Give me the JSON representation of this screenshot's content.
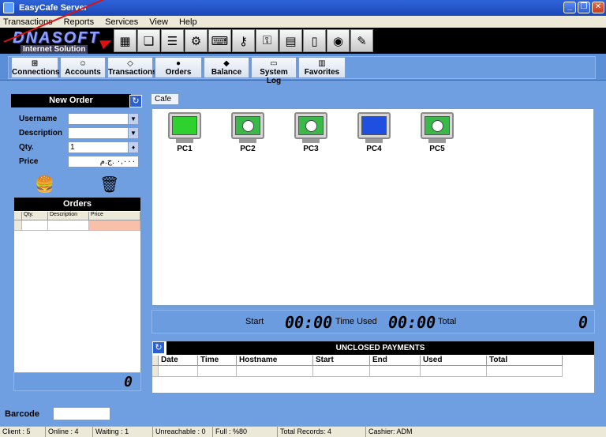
{
  "window": {
    "title": "EasyCafe Server"
  },
  "menu": [
    "Transactions",
    "Reports",
    "Services",
    "View",
    "Help"
  ],
  "logo": {
    "main": "DNASOFT",
    "sub": "Internet Solution"
  },
  "toolbar": [
    "calculator-icon",
    "documents-icon",
    "report-icon",
    "settings-gear-icon",
    "keyboard-icon",
    "keys-icon",
    "key-icon",
    "card-icon",
    "door-icon",
    "globe-icon",
    "edit-icon"
  ],
  "tabs": [
    "Connections",
    "Accounts",
    "Transactions",
    "Orders",
    "Balance",
    "System Log",
    "Favorites"
  ],
  "new_order": {
    "title": "New Order",
    "username_label": "Username",
    "description_label": "Description",
    "qty_label": "Qty.",
    "qty_value": "1",
    "price_label": "Price",
    "price_value": "٠,٠٠٠ .ج.م"
  },
  "orders": {
    "title": "Orders",
    "columns": [
      "Qty.",
      "Description",
      "Price"
    ],
    "total": "0"
  },
  "cafe": {
    "tab_label": "Cafe",
    "pcs": [
      {
        "name": "PC1",
        "status": "active"
      },
      {
        "name": "PC2",
        "status": "timer"
      },
      {
        "name": "PC3",
        "status": "timer"
      },
      {
        "name": "PC4",
        "status": "idle"
      },
      {
        "name": "PC5",
        "status": "timer"
      }
    ],
    "colors": {
      "active": "#2fd12f",
      "idle": "#1f4fe0",
      "timer": "#3bb84a"
    }
  },
  "timer": {
    "start_label": "Start",
    "start_value": "00:00",
    "used_label": "Time Used",
    "used_value": "00:00",
    "total_label": "Total",
    "total_value": "0"
  },
  "unclosed": {
    "title": "UNCLOSED PAYMENTS",
    "columns": [
      "Date",
      "Time",
      "Hostname",
      "Start",
      "End",
      "Used",
      "Total"
    ]
  },
  "barcode": {
    "label": "Barcode"
  },
  "status": [
    "Client : 5",
    "Online : 4",
    "Waiting : 1",
    "Unreachable : 0",
    "Full : %80",
    "Total Records: 4",
    "Cashier: ADM"
  ]
}
